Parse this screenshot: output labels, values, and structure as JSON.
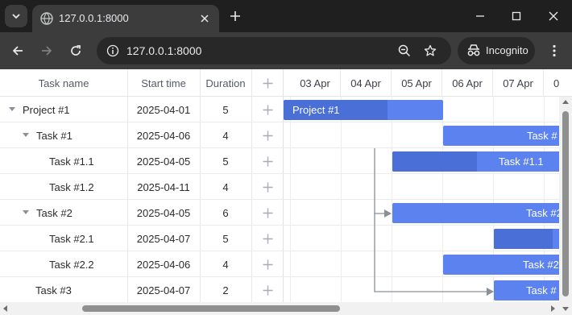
{
  "browser": {
    "tab_title": "127.0.0.1:8000",
    "url": "127.0.0.1:8000",
    "incognito_label": "Incognito"
  },
  "grid": {
    "columns": [
      "Task name",
      "Start time",
      "Duration"
    ],
    "rows": [
      {
        "name": "Project #1",
        "start": "2025-04-01",
        "duration": "5",
        "expander": true
      },
      {
        "name": "Task #1",
        "start": "2025-04-06",
        "duration": "4",
        "expander": true
      },
      {
        "name": "Task #1.1",
        "start": "2025-04-05",
        "duration": "5",
        "expander": false
      },
      {
        "name": "Task #1.2",
        "start": "2025-04-11",
        "duration": "4",
        "expander": false
      },
      {
        "name": "Task #2",
        "start": "2025-04-05",
        "duration": "6",
        "expander": true
      },
      {
        "name": "Task #2.1",
        "start": "2025-04-07",
        "duration": "5",
        "expander": false
      },
      {
        "name": "Task #2.2",
        "start": "2025-04-06",
        "duration": "4",
        "expander": false
      },
      {
        "name": "Task #3",
        "start": "2025-04-07",
        "duration": "2",
        "expander": false
      }
    ]
  },
  "timeline": {
    "scale": [
      "03 Apr",
      "04 Apr",
      "05 Apr",
      "06 Apr",
      "07 Apr",
      "0"
    ],
    "bars": [
      {
        "label": "Project #1",
        "progress": 0.65
      },
      {
        "label": "Task #",
        "progress": 0
      },
      {
        "label": "Task #1.1",
        "progress": 0.5
      },
      {
        "label": "Task #",
        "progress": 0
      },
      {
        "label": "Task #2",
        "progress": 0.0
      },
      {
        "label": "",
        "progress": 0.75
      },
      {
        "label": "Task #2",
        "progress": 0
      },
      {
        "label": "Task #",
        "progress": 0
      }
    ]
  }
}
